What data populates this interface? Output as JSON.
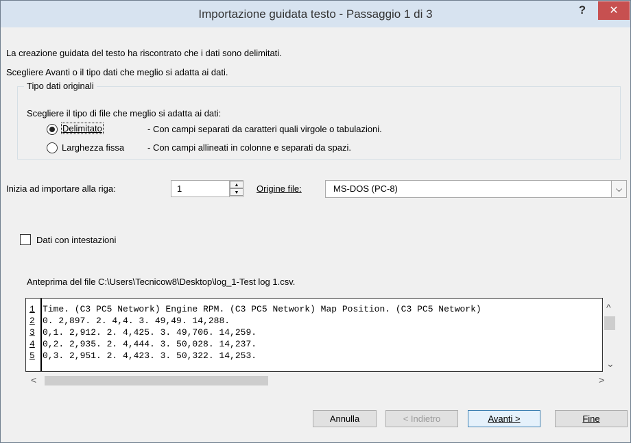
{
  "window": {
    "title": "Importazione guidata testo - Passaggio 1 di 3",
    "help_glyph": "?",
    "close_glyph": "✕"
  },
  "intro": {
    "line1": "La creazione guidata del testo ha riscontrato che i dati sono delimitati.",
    "line2": "Scegliere Avanti o il tipo dati che meglio si adatta ai dati."
  },
  "group": {
    "title": "Tipo dati originali",
    "prompt": "Scegliere il tipo di file che meglio si adatta ai dati:",
    "options": [
      {
        "label": "Delimitato",
        "description": "- Con campi separati da caratteri quali virgole o tabulazioni.",
        "selected": true
      },
      {
        "label": "Larghezza fissa",
        "description": "- Con campi allineati in colonne e separati da spazi.",
        "selected": false
      }
    ]
  },
  "start_row": {
    "label": "Inizia ad importare alla riga:",
    "value": "1"
  },
  "origin": {
    "label": "Origine file:",
    "value": "MS-DOS (PC-8)"
  },
  "headers_checkbox": {
    "label": "Dati con intestazioni",
    "checked": false
  },
  "preview": {
    "caption": "Anteprima del file C:\\Users\\Tecnicow8\\Desktop\\log_1-Test log 1.csv.",
    "rows": [
      {
        "num": "1",
        "text": "Time. (C3 PC5 Network) Engine RPM. (C3 PC5 Network) Map Position. (C3 PC5 Network)"
      },
      {
        "num": "2",
        "text": "0. 2,897. 2. 4,4. 3. 49,49. 14,288."
      },
      {
        "num": "3",
        "text": "0,1. 2,912. 2. 4,425. 3. 49,706. 14,259."
      },
      {
        "num": "4",
        "text": "0,2. 2,935. 2. 4,444. 3. 50,028. 14,237."
      },
      {
        "num": "5",
        "text": "0,3. 2,951. 2. 4,423. 3. 50,322. 14,253."
      }
    ]
  },
  "buttons": {
    "cancel": "Annulla",
    "back": "< Indietro",
    "next": "Avanti >",
    "finish": "Fine"
  }
}
